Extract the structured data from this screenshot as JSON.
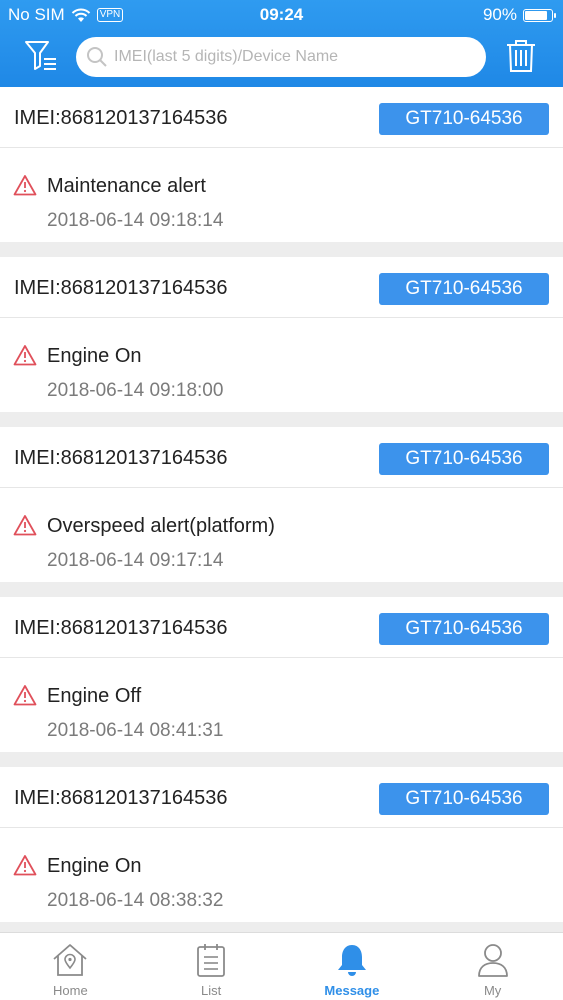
{
  "status_bar": {
    "carrier": "No SIM",
    "vpn": "VPN",
    "time": "09:24",
    "battery": "90%"
  },
  "header": {
    "search_placeholder": "IMEI(last 5 digits)/Device Name"
  },
  "messages": [
    {
      "imei": "IMEI:868120137164536",
      "device": "GT710-64536",
      "alert": "Maintenance alert",
      "time": "2018-06-14 09:18:14"
    },
    {
      "imei": "IMEI:868120137164536",
      "device": "GT710-64536",
      "alert": "Engine On",
      "time": "2018-06-14 09:18:00"
    },
    {
      "imei": "IMEI:868120137164536",
      "device": "GT710-64536",
      "alert": "Overspeed alert(platform)",
      "time": "2018-06-14 09:17:14"
    },
    {
      "imei": "IMEI:868120137164536",
      "device": "GT710-64536",
      "alert": "Engine Off",
      "time": "2018-06-14 08:41:31"
    },
    {
      "imei": "IMEI:868120137164536",
      "device": "GT710-64536",
      "alert": "Engine On",
      "time": "2018-06-14 08:38:32"
    }
  ],
  "tabs": [
    {
      "label": "Home",
      "icon": "home-icon",
      "active": false
    },
    {
      "label": "List",
      "icon": "list-icon",
      "active": false
    },
    {
      "label": "Message",
      "icon": "bell-icon",
      "active": true
    },
    {
      "label": "My",
      "icon": "user-icon",
      "active": false
    }
  ],
  "colors": {
    "header_blue": "#1f88e6",
    "badge_blue": "#3c93ec",
    "alert_red": "#e0505b",
    "active_tab": "#2f8fe8"
  }
}
